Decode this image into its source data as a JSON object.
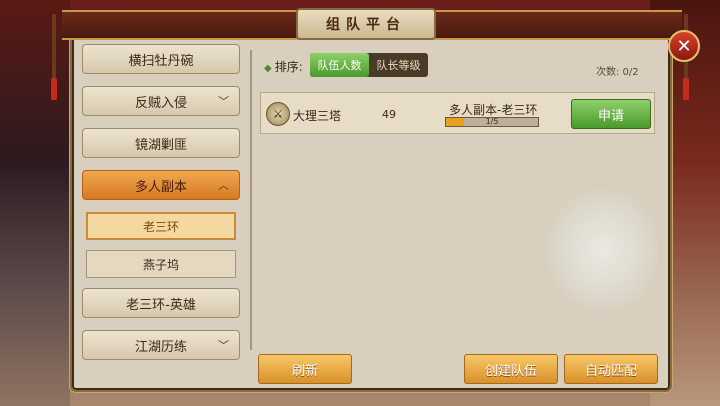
{
  "window": {
    "title": "组队平台"
  },
  "sidebar": {
    "items": [
      {
        "label": "横扫牡丹碗",
        "chevron": ""
      },
      {
        "label": "反贼入侵",
        "chevron": "﹀"
      },
      {
        "label": "镜湖剿匪",
        "chevron": ""
      },
      {
        "label": "多人副本",
        "chevron": "︿"
      },
      {
        "label": "老三环-英雄",
        "chevron": ""
      },
      {
        "label": "江湖历练",
        "chevron": "﹀"
      }
    ],
    "subitems": [
      {
        "label": "老三环"
      },
      {
        "label": "燕子坞"
      }
    ]
  },
  "sort": {
    "label": "排序:",
    "options": [
      {
        "label": "队伍人数"
      },
      {
        "label": "队长等级"
      }
    ],
    "selected": "队伍人数"
  },
  "count": {
    "text": "次数: 0/2"
  },
  "teams": [
    {
      "name": "大理三塔",
      "level": "49",
      "dungeon": "多人副本-老三环",
      "progress_text": "1/5",
      "progress": 0.2,
      "action": "申请"
    }
  ],
  "buttons": {
    "refresh": "刷新",
    "create_team": "创建队伍",
    "auto_match": "自动匹配"
  },
  "icons": {
    "close": "close-icon",
    "team": "sword-icon"
  },
  "colors": {
    "accent_orange": "#e8942e",
    "accent_green": "#5aaa38",
    "panel": "#d9cfbe"
  }
}
